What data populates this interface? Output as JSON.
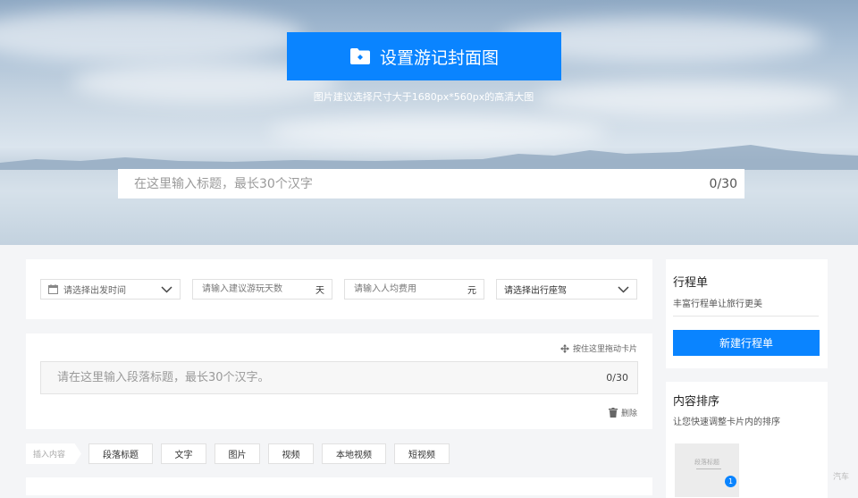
{
  "cover": {
    "button_label": "设置游记封面图",
    "hint": "图片建议选择尺寸大于1680px*560px的高清大图"
  },
  "title": {
    "placeholder": "在这里输入标题，最长30个汉字",
    "counter": "0/30"
  },
  "fields": {
    "date_placeholder": "请选择出发时间",
    "days_placeholder": "请输入建议游玩天数",
    "days_unit": "天",
    "cost_placeholder": "请输入人均费用",
    "cost_unit": "元",
    "vehicle_label": "请选择出行座驾"
  },
  "section": {
    "drag_hint": "按住这里拖动卡片",
    "title_placeholder": "请在这里输入段落标题，最长30个汉字。",
    "counter": "0/30",
    "delete_label": "删除"
  },
  "insert": {
    "label": "插入内容",
    "buttons": [
      "段落标题",
      "文字",
      "图片",
      "视频",
      "本地视频",
      "短视频"
    ]
  },
  "itinerary": {
    "title": "行程单",
    "subtitle": "丰富行程单让旅行更美",
    "button": "新建行程单"
  },
  "ordering": {
    "title": "内容排序",
    "subtitle": "让您快速调整卡片内的排序",
    "thumb_label": "段落标题",
    "thumb_badge": "1"
  },
  "watermark": "汽车",
  "colors": {
    "accent": "#0a84ff",
    "page_bg": "#f4f5f7"
  }
}
